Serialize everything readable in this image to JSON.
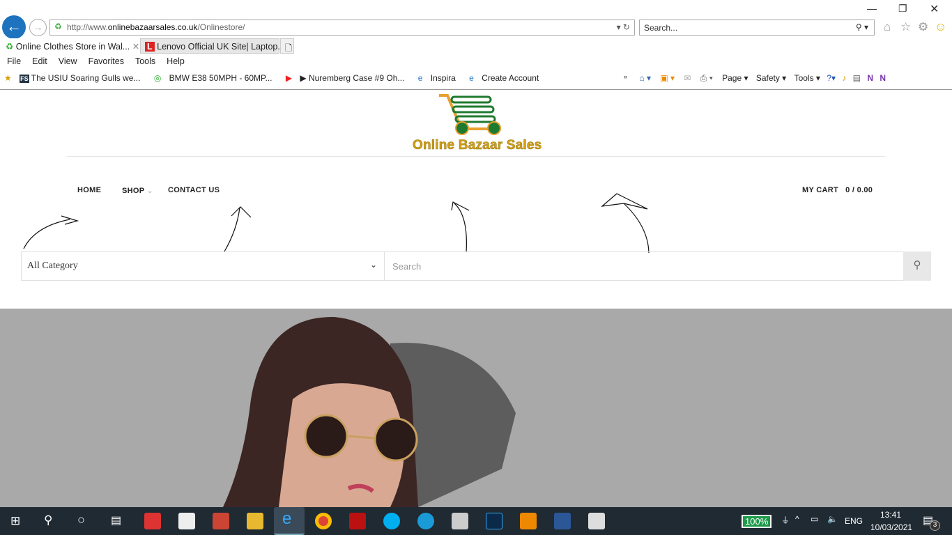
{
  "browser": {
    "url_prefix": "http://www.",
    "url_domain": "onlinebazaarsales.co.uk",
    "url_path": "/Onlinestore/",
    "search_placeholder": "Search...",
    "tabs": [
      {
        "label": "Online Clothes Store in Wal..."
      },
      {
        "label": "Lenovo Official UK Site| Laptop..."
      }
    ],
    "menu": [
      "File",
      "Edit",
      "View",
      "Favorites",
      "Tools",
      "Help"
    ],
    "favorites": [
      "The USIU Soaring Gulls we...",
      "BMW E38 50MPH - 60MP...",
      "▶ Nuremberg Case #9 Oh...",
      "Inspira",
      "Create Account"
    ],
    "commands": [
      "Page ▾",
      "Safety ▾",
      "Tools ▾"
    ]
  },
  "site": {
    "logo_text": "Online Bazaar Sales",
    "nav": [
      "HOME",
      "SHOP",
      "CONTACT US"
    ],
    "cart_label": "MY CART",
    "cart_value": "0 / 0.00",
    "category_select": "All Category",
    "search_placeholder": "Search"
  },
  "taskbar": {
    "battery": "100%",
    "lang": "ENG",
    "time": "13:41",
    "date": "10/03/2021",
    "notifications": "3"
  }
}
